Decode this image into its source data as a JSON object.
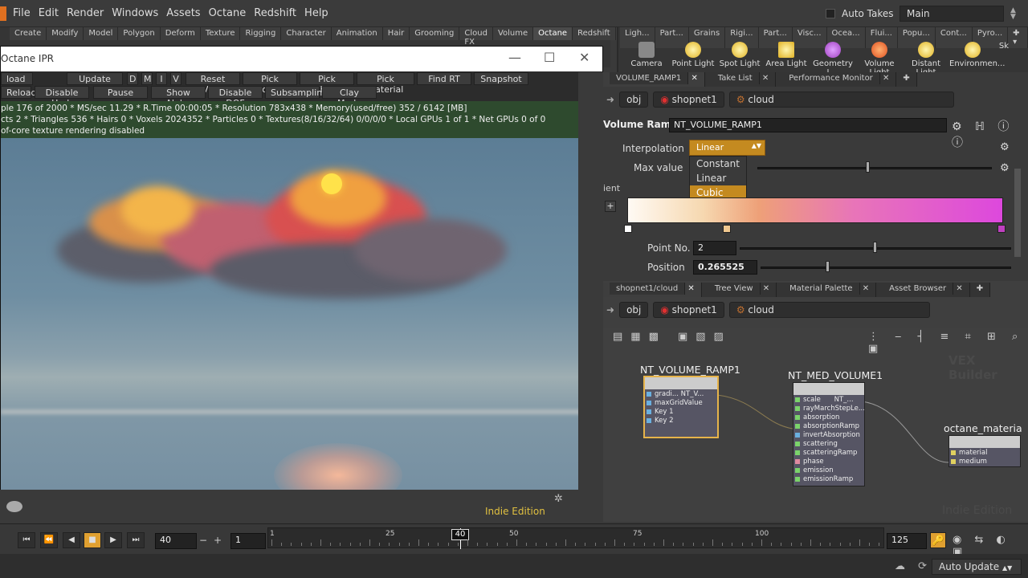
{
  "menubar": {
    "items": [
      "File",
      "Edit",
      "Render",
      "Windows",
      "Assets",
      "Octane",
      "Redshift",
      "Help"
    ],
    "auto_takes": "Auto Takes",
    "desktop": "Main"
  },
  "shelf_left": {
    "tabs": [
      "Create",
      "Modify",
      "Model",
      "Polygon",
      "Deform",
      "Texture",
      "Rigging",
      "Character",
      "Animation",
      "Hair",
      "Grooming",
      "Cloud FX",
      "Volume",
      "Octane",
      "Redshift"
    ],
    "active": "Octane"
  },
  "shelf_right": {
    "tabs": [
      "Ligh...",
      "Part...",
      "Grains",
      "Rigi...",
      "Part...",
      "Visc...",
      "Ocea...",
      "Flui...",
      "Popu...",
      "Cont...",
      "Pyro..."
    ],
    "tools": [
      "Camera",
      "Point Light",
      "Spot Light",
      "Area Light",
      "Geometry L...",
      "Volume Light",
      "Distant Light",
      "Environmen...",
      "Sk"
    ]
  },
  "ipr": {
    "title": "Octane IPR",
    "toolbar1": [
      "load",
      "Update",
      "D",
      "M",
      "I",
      "V",
      "Reset View",
      "Pick Focus",
      "Pick WhiteP",
      "Pick Material",
      "Find RT",
      "Snapshot"
    ],
    "toolbar2": [
      "Reload",
      "Disable Upd.",
      "Pause",
      "Show Alpha",
      "Disable DOF",
      "Subsampling",
      "Clay Mode"
    ],
    "stats": [
      "ple 176 of 2000 * MS/sec 11.29 * R.Time 00:00:05 * Resolution 783x438 * Memory(used/free) 352 / 6142 [MB]",
      "cts 2 * Triangles 536 * Hairs 0 * Voxels 2024352 * Particles 0 * Textures(8/16/32/64) 0/0/0/0 * Local GPUs 1 of 1 * Net GPUs 0 of 0",
      "of-core texture rendering disabled"
    ]
  },
  "viewport": {
    "edition": "Indie Edition"
  },
  "parm": {
    "tabs": [
      "VOLUME_RAMP1",
      "Take List",
      "Performance Monitor"
    ],
    "path": [
      "obj",
      "shopnet1",
      "cloud"
    ],
    "node_type": "Volume Ramp",
    "node_name": "NT_VOLUME_RAMP1",
    "interpolation_label": "Interpolation",
    "interpolation_value": "Linear",
    "interpolation_options": [
      "Constant",
      "Linear",
      "Cubic"
    ],
    "max_value_label": "Max value",
    "gradient_label": "ient",
    "point_no_label": "Point No.",
    "point_no_value": "2",
    "position_label": "Position",
    "position_value": "0.265525"
  },
  "net": {
    "tabs": [
      "shopnet1/cloud",
      "Tree View",
      "Material Palette",
      "Asset Browser"
    ],
    "path": [
      "obj",
      "shopnet1",
      "cloud"
    ],
    "watermark1": "VEX Builder",
    "watermark2": "Indie Edition",
    "node1": {
      "label": "NT_VOLUME_RAMP1",
      "inputs": [
        "gradi...",
        "maxGridValue",
        "Key 1",
        "Key 2"
      ],
      "out": "NT_V..."
    },
    "node2": {
      "label": "NT_MED_VOLUME1",
      "inputs": [
        "scale",
        "rayMarchStepLe...",
        "absorption",
        "absorptionRamp",
        "invertAbsorption",
        "scattering",
        "scatteringRamp",
        "phase",
        "emission",
        "emissionRamp"
      ],
      "out": "NT_..."
    },
    "node3": {
      "label": "octane_materia",
      "inputs": [
        "material",
        "medium"
      ]
    }
  },
  "timeline": {
    "current_frame": "40",
    "start": "1",
    "end": "125",
    "ticks": [
      "1",
      "25",
      "40",
      "50",
      "75",
      "100"
    ]
  },
  "status": {
    "auto_update": "Auto Update"
  }
}
